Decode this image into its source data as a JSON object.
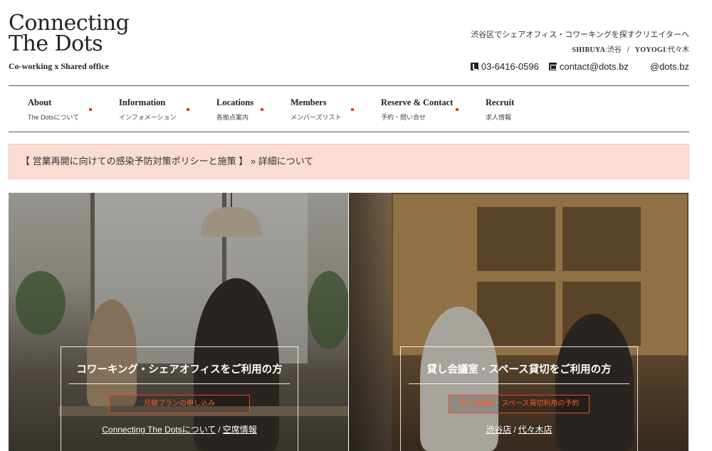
{
  "logo": {
    "title_line1": "Connecting",
    "title_line2": "The Dots",
    "subtitle": "Co-working x Shared office"
  },
  "header": {
    "tagline": "渋谷区でシェアオフィス・コワーキングを探すクリエイターへ",
    "area1_en": "SHIBUYA",
    "area1_ja": ":渋谷",
    "separator": "/",
    "area2_en": "YOYOGI",
    "area2_ja": ":代々木",
    "phone": "03-6416-0596",
    "email": "contact@dots.bz",
    "sns": "@dots.bz",
    "phone_icon": "phone-icon",
    "mail_icon": "mail-icon"
  },
  "nav": {
    "items": [
      {
        "en": "About",
        "ja": "The Dotsについて"
      },
      {
        "en": "Information",
        "ja": "インフォメーション"
      },
      {
        "en": "Locations",
        "ja": "各拠点案内"
      },
      {
        "en": "Members",
        "ja": "メンバーズリスト"
      },
      {
        "en": "Reserve & Contact",
        "ja": "予約・問い合せ"
      },
      {
        "en": "Recruit",
        "ja": "求人情報"
      }
    ],
    "dot_color": "#e04a1e"
  },
  "notice": {
    "text": "【 営業再開に向けての感染予防対策ポリシーと施策 】",
    "link": "» 詳細について",
    "background": "#fbdcd2"
  },
  "hero": {
    "left": {
      "title": "コワーキング・シェアオフィスをご利用の方",
      "button": "月額プランの申し込み",
      "link1": "Connecting The Dotsについて",
      "separator": "/",
      "link2": "空席情報"
    },
    "right": {
      "title": "貸し会議室・スペース貸切をご利用の方",
      "button": "貸し会議室・スペース貸切利用の予約",
      "link1": "渋谷店",
      "separator": "/",
      "link2": "代々木店"
    },
    "accent": "#e84a1c"
  }
}
